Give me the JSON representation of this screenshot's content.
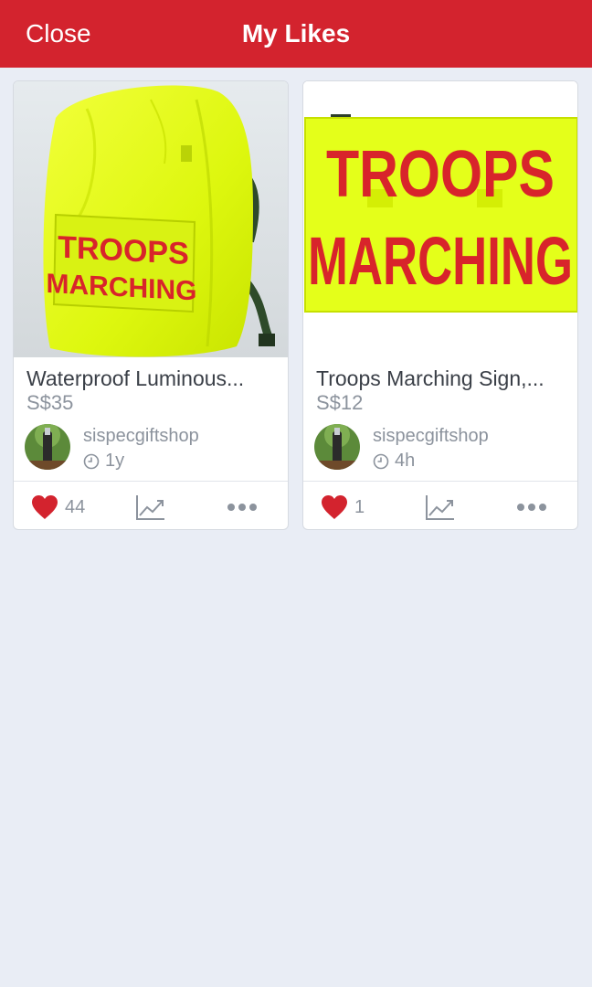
{
  "header": {
    "close_label": "Close",
    "title": "My Likes",
    "bar_color": "#D3232E"
  },
  "listings": [
    {
      "title": "Waterproof Luminous...",
      "price": "S$35",
      "seller": "sispecgiftshop",
      "age": "1y",
      "likes": "44",
      "liked": true,
      "image_text": [
        "TROOPS",
        "MARCHING"
      ]
    },
    {
      "title": "Troops Marching Sign,...",
      "price": "S$12",
      "seller": "sispecgiftshop",
      "age": "4h",
      "likes": "1",
      "liked": true,
      "image_text": [
        "TROOPS",
        "MARCHING"
      ]
    }
  ],
  "icons": {
    "like": "heart-icon",
    "stats": "line-chart-icon",
    "more": "more-dots-icon",
    "time": "clock-icon"
  },
  "colors": {
    "heart": "#D3232E",
    "neon_yellow": "#E4FF1A",
    "sign_text": "#D8242B",
    "background": "#E9EDF5"
  }
}
